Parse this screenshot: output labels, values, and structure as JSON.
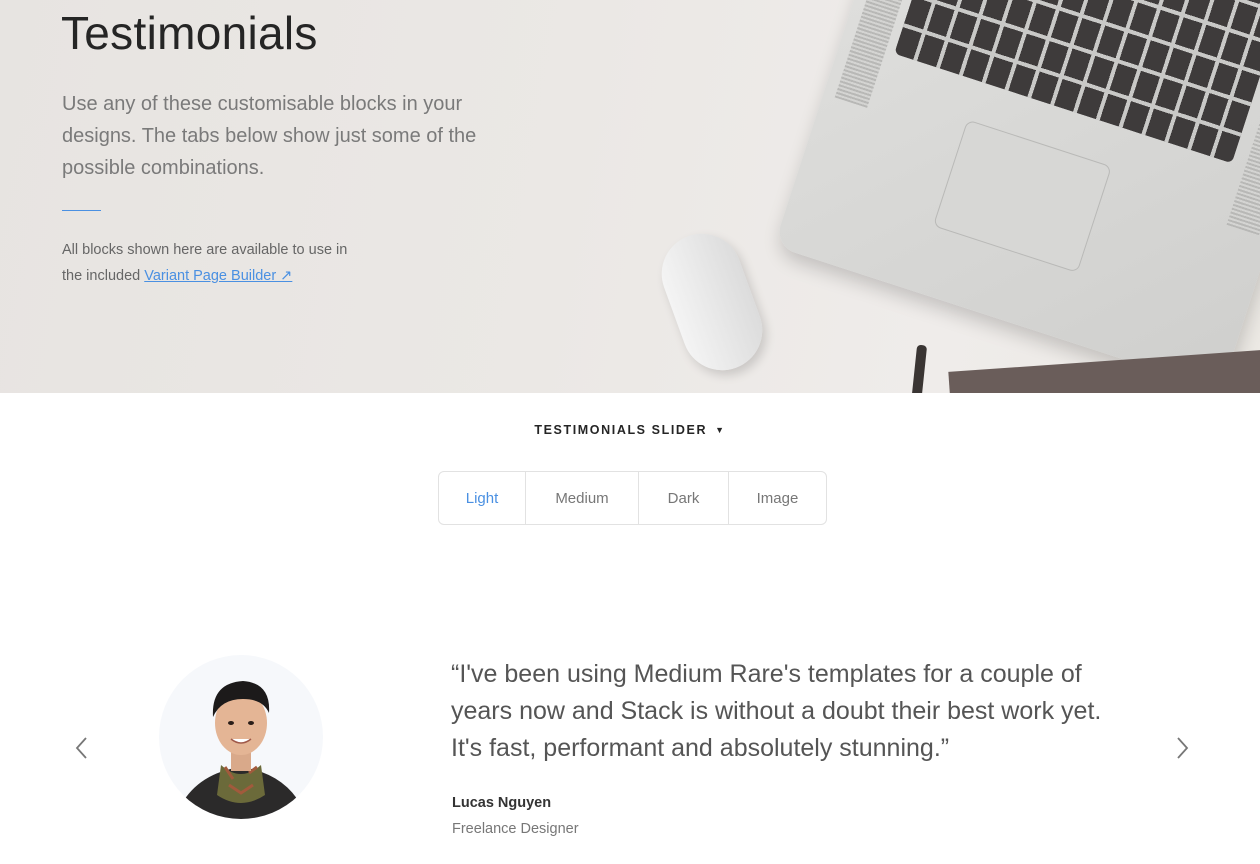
{
  "hero": {
    "title": "Testimonials",
    "lead": "Use any of these customisable blocks in your designs. The tabs below show just some of the possible combinations.",
    "note_line1": "All blocks shown here are available to use in",
    "note_line2": "the included",
    "link_label": "Variant Page Builder ↗"
  },
  "selector": {
    "label": "TESTIMONIALS SLIDER",
    "caret": "▼"
  },
  "tabs": [
    {
      "label": "Light",
      "active": true
    },
    {
      "label": "Medium",
      "active": false
    },
    {
      "label": "Dark",
      "active": false
    },
    {
      "label": "Image",
      "active": false
    }
  ],
  "testimonial": {
    "quote": "“I've been using Medium Rare's templates for a couple of years now and Stack is without a doubt their best work yet. It's fast, performant and absolutely stunning.”",
    "author": "Lucas Nguyen",
    "role": "Freelance Designer"
  },
  "icons": {
    "prev": "chevron-left-icon",
    "next": "chevron-right-icon"
  },
  "colors": {
    "accent": "#4a90e2",
    "heading": "#252525",
    "body": "#666666"
  }
}
